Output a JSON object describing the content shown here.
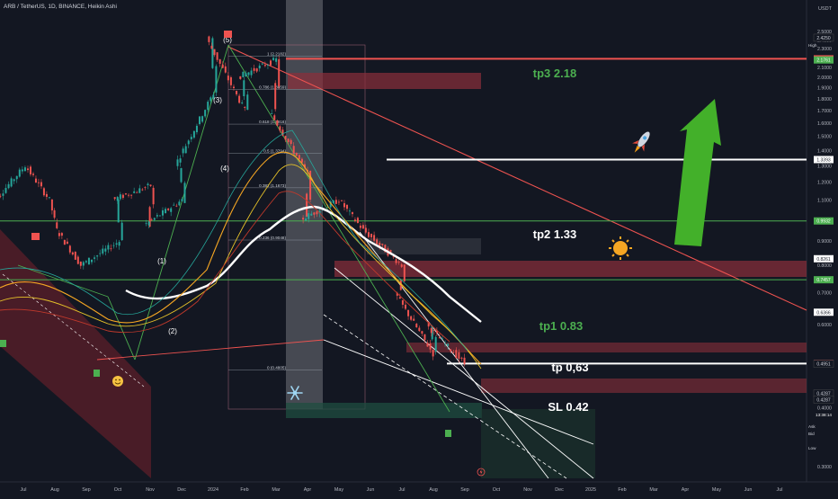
{
  "header": {
    "symbol_title": "ARB / TetherUS, 1D, BINANCE, Heikin Ashi"
  },
  "currency_label": "USDT",
  "colors": {
    "background": "#131722",
    "up_candle": "#26a69a",
    "down_candle": "#ef5350",
    "target_green": "#4caf50",
    "red_line": "#ef5350",
    "white_line": "#ffffff",
    "zone_red": "#8b2f3a",
    "arrow_green": "#43b02a"
  },
  "chart_data": {
    "type": "candlestick",
    "title": "",
    "x_ticks": [
      "Jul",
      "Aug",
      "Sep",
      "Oct",
      "Nov",
      "Dec",
      "2024",
      "Feb",
      "Mar",
      "Apr",
      "May",
      "Jun",
      "Jul",
      "Aug",
      "Sep",
      "Oct",
      "Nov",
      "Dec",
      "2025",
      "Feb",
      "Mar",
      "Apr",
      "May",
      "Jun",
      "Jul"
    ],
    "y_ticks": [
      "2.5000",
      "2.4000",
      "2.3000",
      "2.2000",
      "2.1000",
      "2.0000",
      "1.9000",
      "1.8000",
      "1.7000",
      "1.6000",
      "1.5000",
      "1.4000",
      "1.3000",
      "1.2000",
      "1.1000",
      "1.0000",
      "0.9000",
      "0.8000",
      "0.7000",
      "0.6000",
      "0.5000",
      "0.4000",
      "0.3000"
    ],
    "y_scale": "log",
    "price_path": [
      {
        "x": "Jun 2023",
        "y": 1.05
      },
      {
        "x": "Jul 2023",
        "y": 1.3
      },
      {
        "x": "Aug 2023",
        "y": 1.1
      },
      {
        "x": "Aug 2023",
        "y": 0.95
      },
      {
        "x": "Sep 2023",
        "y": 0.8
      },
      {
        "x": "Oct 2023",
        "y": 0.9
      },
      {
        "x": "Oct 2023",
        "y": 1.1
      },
      {
        "x": "Nov 2023",
        "y": 1.18
      },
      {
        "x": "Nov 2023",
        "y": 0.97
      },
      {
        "x": "Dec 2023",
        "y": 1.1
      },
      {
        "x": "Dec 2023",
        "y": 1.3
      },
      {
        "x": "Jan 2024",
        "y": 1.85
      },
      {
        "x": "Jan 2024",
        "y": 2.42
      },
      {
        "x": "Feb 2024",
        "y": 1.7
      },
      {
        "x": "Feb 2024",
        "y": 2.0
      },
      {
        "x": "Mar 2024",
        "y": 2.18
      },
      {
        "x": "Mar 2024",
        "y": 1.7
      },
      {
        "x": "Apr 2024",
        "y": 1.25
      },
      {
        "x": "Apr 2024",
        "y": 1.0
      },
      {
        "x": "May 2024",
        "y": 1.1
      },
      {
        "x": "Jun 2024",
        "y": 0.95
      },
      {
        "x": "Jul 2024",
        "y": 0.8
      },
      {
        "x": "Jul 2024",
        "y": 0.7
      },
      {
        "x": "Aug 2024",
        "y": 0.52
      },
      {
        "x": "Aug 2024",
        "y": 0.6
      },
      {
        "x": "Sep 2024",
        "y": 0.4958
      }
    ],
    "horizontal_levels": [
      {
        "label": "tp3 2.18",
        "value": 2.188,
        "color": "#ef5350"
      },
      {
        "label": "tp2 1.33",
        "value": 1.3393,
        "color": "#ffffff"
      },
      {
        "label": "tp1 0.83",
        "value": 0.9932,
        "color": "#4caf50"
      },
      {
        "label": "tp 0,63",
        "value": 0.7457,
        "color": "#4caf50"
      },
      {
        "label": "SL 0.42",
        "value": 0.4958,
        "color": "#ffffff"
      }
    ],
    "fib_levels": [
      {
        "label": "1 (2.2182)",
        "value": 2.2182
      },
      {
        "label": "0.786 (1.8859)",
        "value": 1.8859
      },
      {
        "label": "0.618 (1.5916)",
        "value": 1.5916
      },
      {
        "label": "0.5 (1.3794)",
        "value": 1.3794
      },
      {
        "label": "0.382 (1.1673)",
        "value": 1.1673
      },
      {
        "label": "0.236 (0.9048)",
        "value": 0.9048
      },
      {
        "label": "0 (0.4805)",
        "value": 0.4805
      }
    ],
    "wave_labels": [
      "(1)",
      "(2)",
      "(3)",
      "(4)",
      "(5)"
    ],
    "target_labels": [
      "tp3 2.18",
      "tp2 1.33",
      "tp1 0.83",
      "tp 0,63",
      "SL 0.42"
    ],
    "price_tags": [
      {
        "text": "2.4250",
        "value": 2.425,
        "bg": "#131722",
        "fg": "#d1d4dc"
      },
      {
        "text": "2.1880",
        "value": 2.188,
        "bg": "#ef5350",
        "fg": "#ffffff"
      },
      {
        "text": "2.1761",
        "value": 2.1761,
        "bg": "#4caf50",
        "fg": "#ffffff"
      },
      {
        "text": "1.3393",
        "value": 1.3393,
        "bg": "#ffffff",
        "fg": "#131722"
      },
      {
        "text": "0.9932",
        "value": 0.9932,
        "bg": "#4caf50",
        "fg": "#ffffff"
      },
      {
        "text": "0.8261",
        "value": 0.8261,
        "bg": "#ffffff",
        "fg": "#131722"
      },
      {
        "text": "0.7457",
        "value": 0.7457,
        "bg": "#4caf50",
        "fg": "#ffffff"
      },
      {
        "text": "0.6366",
        "value": 0.6366,
        "bg": "#ffffff",
        "fg": "#131722"
      },
      {
        "text": "0.4958",
        "value": 0.4958,
        "bg": "#ef5350",
        "fg": "#ffffff"
      },
      {
        "text": "0.4951",
        "value": 0.4951,
        "bg": "#131722",
        "fg": "#d1d4dc"
      },
      {
        "text": "0.4287",
        "value": 0.4287,
        "bg": "#131722",
        "fg": "#d1d4dc"
      },
      {
        "text": "0.4287",
        "value": 0.4287,
        "bg": "#131722",
        "fg": "#d1d4dc"
      }
    ],
    "side_labels": {
      "high": "High",
      "low": "Low",
      "ask": "Ask",
      "bid": "Bid"
    },
    "countdown": "13:38:14",
    "grid": false,
    "legend": "none"
  }
}
